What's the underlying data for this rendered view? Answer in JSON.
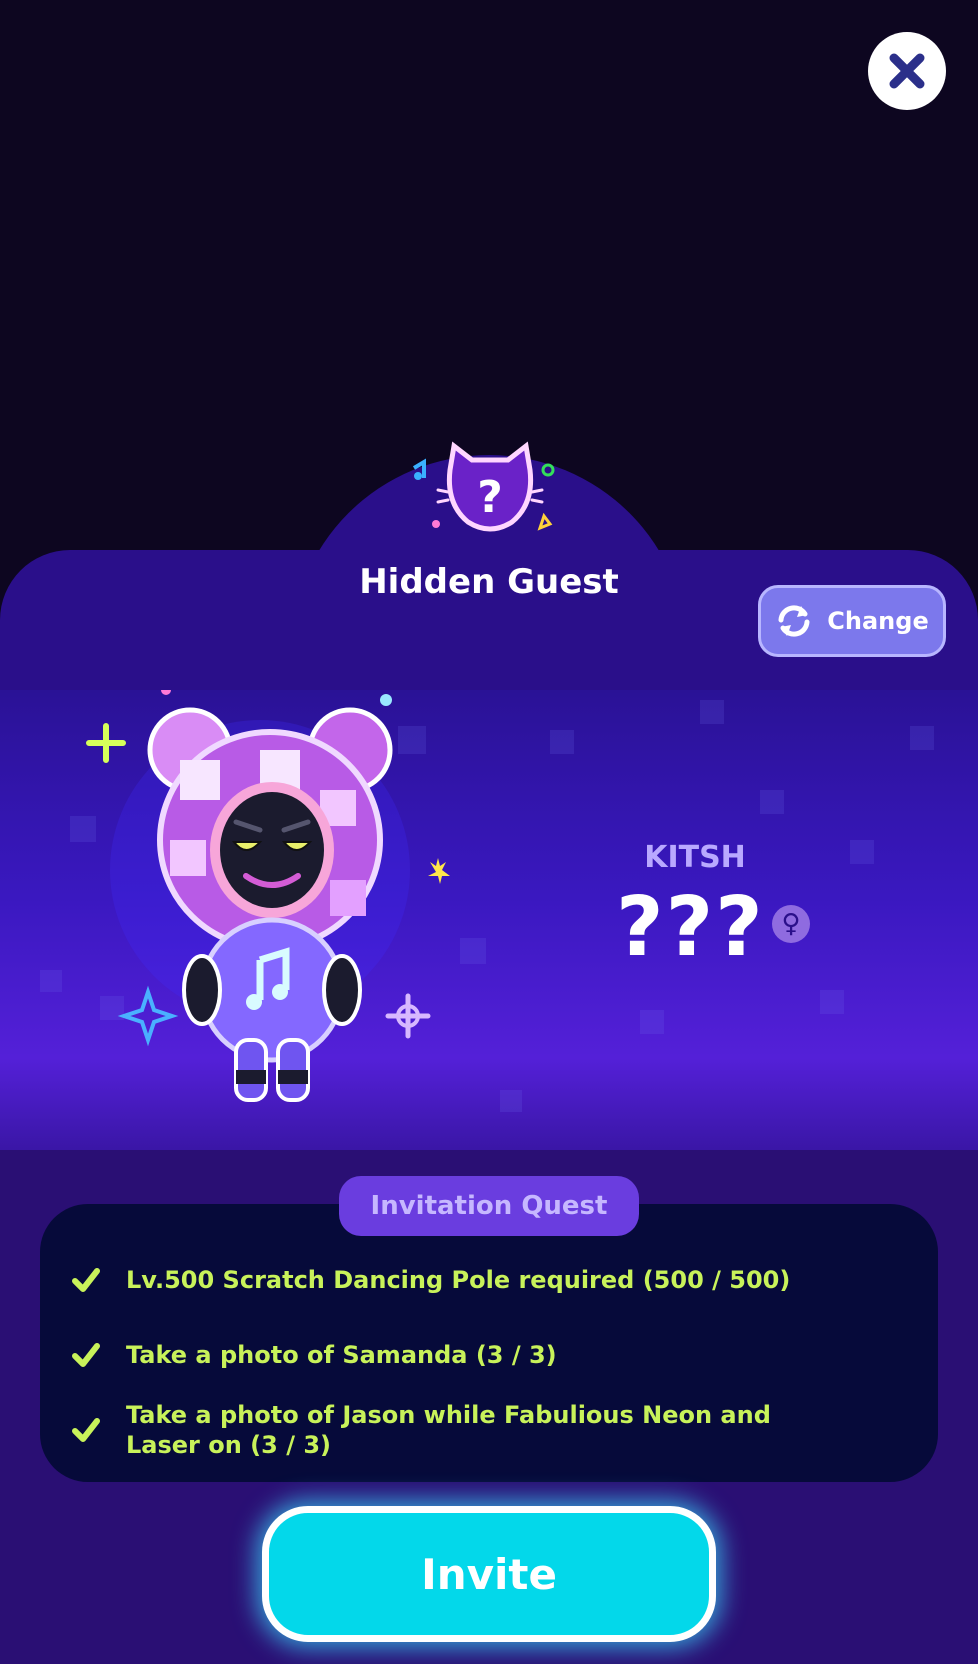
{
  "header": {
    "close_icon": "close-icon",
    "title": "Hidden Guest",
    "change_label": "Change",
    "change_icon": "swap-icon",
    "emblem_icon": "question-cat-icon"
  },
  "guest": {
    "species": "KITSH",
    "name": "???",
    "gender_symbol": "♀",
    "gender_icon": "female-icon"
  },
  "quest": {
    "tab_label": "Invitation Quest",
    "items": [
      {
        "text": "Lv.500 Scratch Dancing Pole required (500 / 500)",
        "done": true
      },
      {
        "text": "Take a photo of Samanda (3 / 3)",
        "done": true
      },
      {
        "text": "Take a photo of Jason while Fabulious Neon and Laser on (3 / 3)",
        "done": true
      }
    ]
  },
  "actions": {
    "invite_label": "Invite"
  },
  "colors": {
    "background": "#0d0620",
    "panel": "#2a0f8a",
    "accent_cyan": "#03d8ea",
    "check_green": "#c8f25a"
  }
}
